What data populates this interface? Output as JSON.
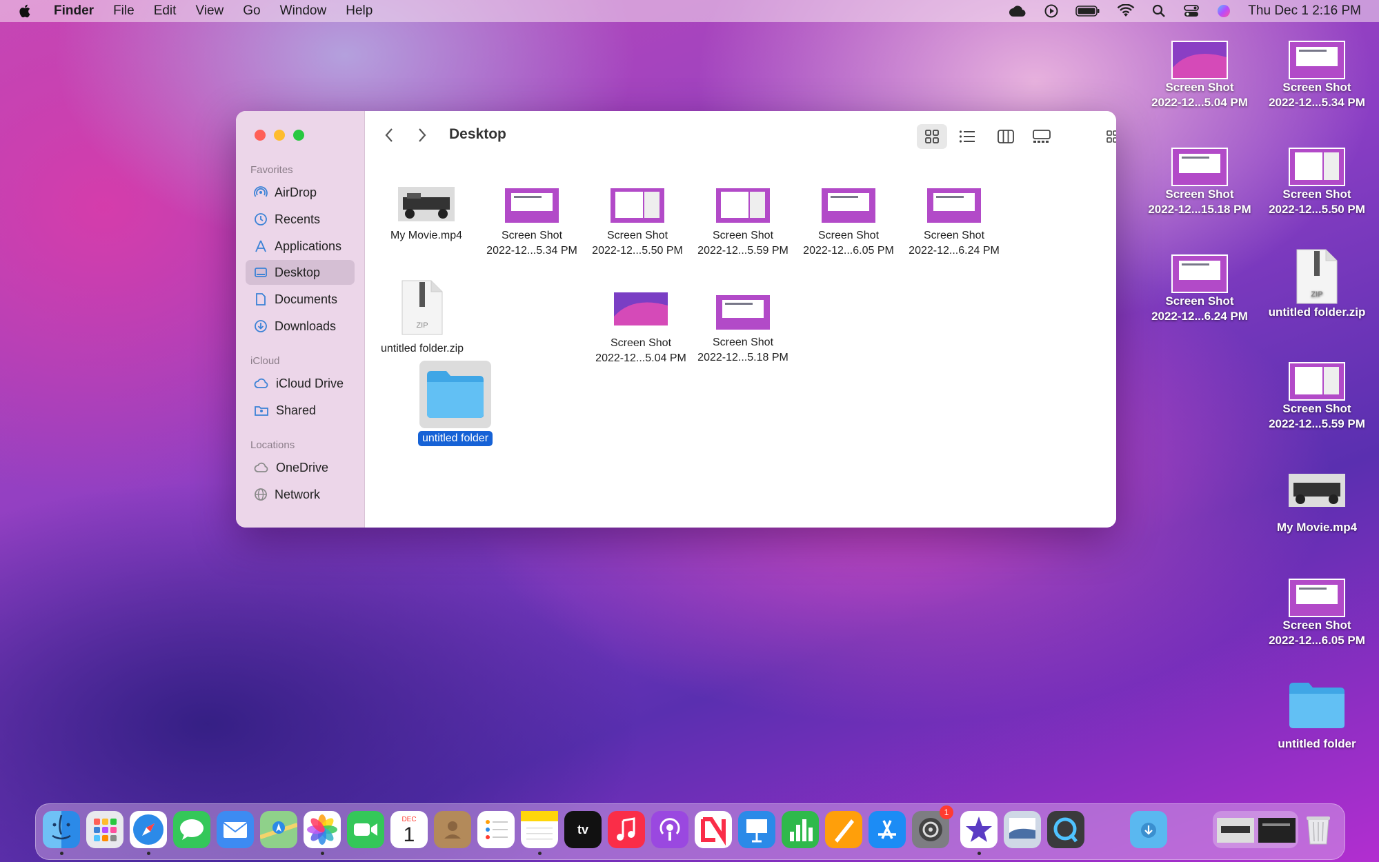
{
  "menubar": {
    "app": "Finder",
    "items": [
      "File",
      "Edit",
      "View",
      "Go",
      "Window",
      "Help"
    ],
    "clock": "Thu Dec 1  2:16 PM"
  },
  "finder": {
    "title": "Desktop",
    "sidebar": {
      "favorites_header": "Favorites",
      "favorites": [
        {
          "label": "AirDrop",
          "icon": "airdrop-icon"
        },
        {
          "label": "Recents",
          "icon": "clock-icon"
        },
        {
          "label": "Applications",
          "icon": "applications-icon"
        },
        {
          "label": "Desktop",
          "icon": "desktop-icon",
          "selected": true
        },
        {
          "label": "Documents",
          "icon": "document-icon"
        },
        {
          "label": "Downloads",
          "icon": "download-icon"
        }
      ],
      "icloud_header": "iCloud",
      "icloud": [
        {
          "label": "iCloud Drive",
          "icon": "cloud-icon"
        },
        {
          "label": "Shared",
          "icon": "shared-folder-icon"
        }
      ],
      "locations_header": "Locations",
      "locations": [
        {
          "label": "OneDrive",
          "icon": "cloud-icon"
        },
        {
          "label": "Network",
          "icon": "globe-icon"
        }
      ]
    },
    "files": [
      {
        "line1": "My Movie.mp4",
        "line2": "",
        "kind": "movie"
      },
      {
        "line1": "Screen Shot",
        "line2": "2022-12...5.34 PM",
        "kind": "screenshot"
      },
      {
        "line1": "Screen Shot",
        "line2": "2022-12...5.50 PM",
        "kind": "screenshot"
      },
      {
        "line1": "Screen Shot",
        "line2": "2022-12...5.59 PM",
        "kind": "screenshot"
      },
      {
        "line1": "Screen Shot",
        "line2": "2022-12...6.05 PM",
        "kind": "screenshot"
      },
      {
        "line1": "Screen Shot",
        "line2": "2022-12...6.24 PM",
        "kind": "screenshot"
      },
      {
        "line1": "untitled folder.zip",
        "line2": "",
        "kind": "zip"
      },
      {
        "line1": "Screen Shot",
        "line2": "2022-12...5.04 PM",
        "kind": "wallpaper"
      },
      {
        "line1": "Screen Shot",
        "line2": "2022-12...5.18 PM",
        "kind": "screenshot"
      },
      {
        "line1": "untitled folder",
        "line2": "",
        "kind": "folder",
        "selected": true
      }
    ],
    "zip_badge": "ZIP"
  },
  "desktop": {
    "icons": [
      {
        "line1": "Screen Shot",
        "line2": "2022-12...5.04 PM"
      },
      {
        "line1": "Screen Shot",
        "line2": "2022-12...5.34 PM"
      },
      {
        "line1": "Screen Shot",
        "line2": "2022-12...15.18 PM"
      },
      {
        "line1": "Screen Shot",
        "line2": "2022-12...5.50 PM"
      },
      {
        "line1": "Screen Shot",
        "line2": "2022-12...6.24 PM"
      },
      {
        "line1": "untitled folder.zip",
        "line2": ""
      },
      {
        "line1": "Screen Shot",
        "line2": "2022-12...5.59 PM"
      },
      {
        "line1": "My Movie.mp4",
        "line2": ""
      },
      {
        "line1": "Screen Shot",
        "line2": "2022-12...6.05 PM"
      },
      {
        "line1": "untitled folder",
        "line2": ""
      }
    ]
  },
  "dock": {
    "calendar_month": "DEC",
    "calendar_day": "1",
    "tv_label": "tv",
    "settings_badge": "1"
  },
  "colors": {
    "selection": "#1662d6",
    "folder": "#5ab8f0",
    "close": "#ff5f57",
    "minimize": "#febc2e",
    "zoom": "#28c840"
  }
}
